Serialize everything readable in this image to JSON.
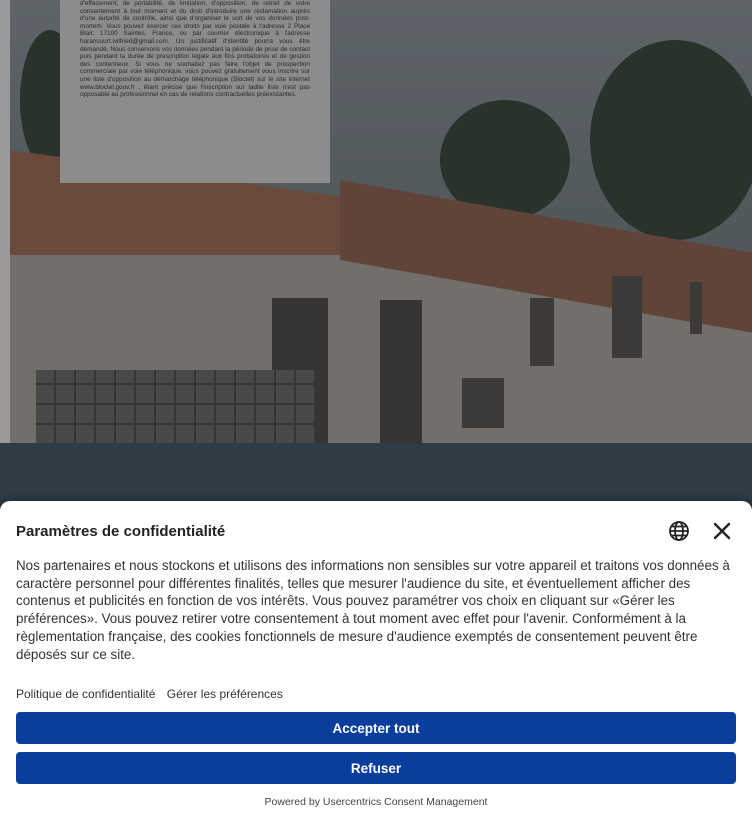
{
  "background": {
    "privacy_text": "d'effacement, de portabilité, de limitation, d'opposition, de retrait de votre consentement à tout moment et du droit d'introduire une réclamation auprès d'une autorité de contrôle, ainsi que d'organiser le sort de vos données post-mortem. Vous pouvez exercer ces droits par voie postale à l'adresse 2 Place Blair, 17100 Saintes, France, ou par courrier électronique à l'adresse harancourt.wilfried@gmail.com. Un justificatif d'identité pourra vous être demandé. Nous conservons vos données pendant la période de prise de contact puis pendant la durée de prescription légale aux fins probatoires et de gestion des contentieux. Si vous ne souhaitez pas faire l'objet de prospection commerciale par voie téléphonique, vous pouvez gratuitement vous inscrire sur une liste d'opposition au démarchage téléphonique (Bloctel) sur le site internet www.bloctel.gouv.fr , étant précisé que l'inscription sur ladite liste n'est pas opposable au professionnel en cas de relations contractuelles préexistantes."
  },
  "consent": {
    "title": "Paramètres de confidentialité",
    "description": "Nos partenaires et nous stockons et utilisons des informations non sensibles sur votre appareil et traitons vos données à caractère personnel pour différentes finalités, telles que mesurer l'audience du site, et éventuellement afficher des contenus et publicités en fonction de vos intérêts. Vous pouvez paramétrer vos choix en cliquant sur «Gérer les préférences». Vous pouvez retirer votre consentement à tout moment avec effet pour l'avenir. Conformément à la règlementation française, des cookies fonctionnels de mesure d'audience exemptés de consentement peuvent être déposés sur ce site.",
    "privacy_policy_link": "Politique de confidentialité",
    "manage_preferences_link": "Gérer les préférences",
    "accept_label": "Accepter tout",
    "refuse_label": "Refuser",
    "powered_by": "Powered by Usercentrics Consent Management",
    "icons": {
      "language": "globe-icon",
      "close": "close-icon"
    },
    "colors": {
      "button": "#0a3e9c"
    }
  }
}
